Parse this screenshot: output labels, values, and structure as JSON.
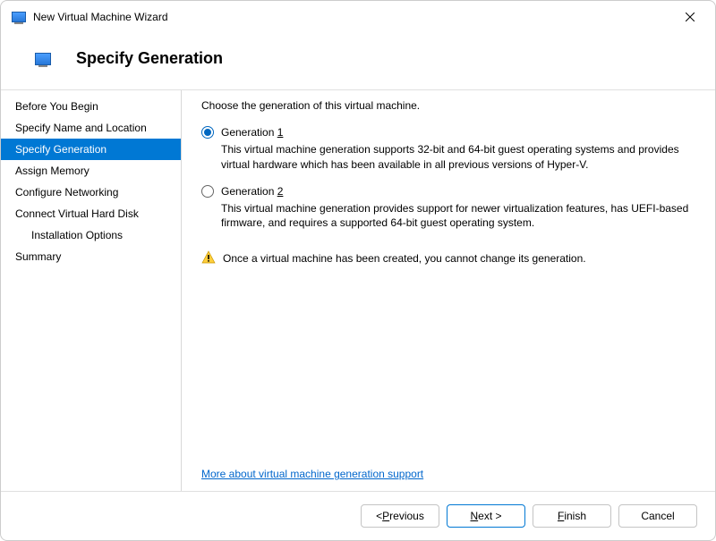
{
  "titlebar": {
    "title": "New Virtual Machine Wizard"
  },
  "header": {
    "title": "Specify Generation"
  },
  "sidebar": {
    "items": [
      {
        "label": "Before You Begin",
        "selected": false,
        "indented": false
      },
      {
        "label": "Specify Name and Location",
        "selected": false,
        "indented": false
      },
      {
        "label": "Specify Generation",
        "selected": true,
        "indented": false
      },
      {
        "label": "Assign Memory",
        "selected": false,
        "indented": false
      },
      {
        "label": "Configure Networking",
        "selected": false,
        "indented": false
      },
      {
        "label": "Connect Virtual Hard Disk",
        "selected": false,
        "indented": false
      },
      {
        "label": "Installation Options",
        "selected": false,
        "indented": true
      },
      {
        "label": "Summary",
        "selected": false,
        "indented": false
      }
    ]
  },
  "content": {
    "instruction": "Choose the generation of this virtual machine.",
    "options": [
      {
        "label_prefix": "Generation ",
        "label_accel": "1",
        "checked": true,
        "description": "This virtual machine generation supports 32-bit and 64-bit guest operating systems and provides virtual hardware which has been available in all previous versions of Hyper-V."
      },
      {
        "label_prefix": "Generation ",
        "label_accel": "2",
        "checked": false,
        "description": "This virtual machine generation provides support for newer virtualization features, has UEFI-based firmware, and requires a supported 64-bit guest operating system."
      }
    ],
    "warning": "Once a virtual machine has been created, you cannot change its generation.",
    "more_link": "More about virtual machine generation support"
  },
  "footer": {
    "previous_prefix": "< ",
    "previous_accel": "P",
    "previous_suffix": "revious",
    "next_accel": "N",
    "next_suffix": "ext >",
    "finish_accel": "F",
    "finish_suffix": "inish",
    "cancel": "Cancel"
  }
}
